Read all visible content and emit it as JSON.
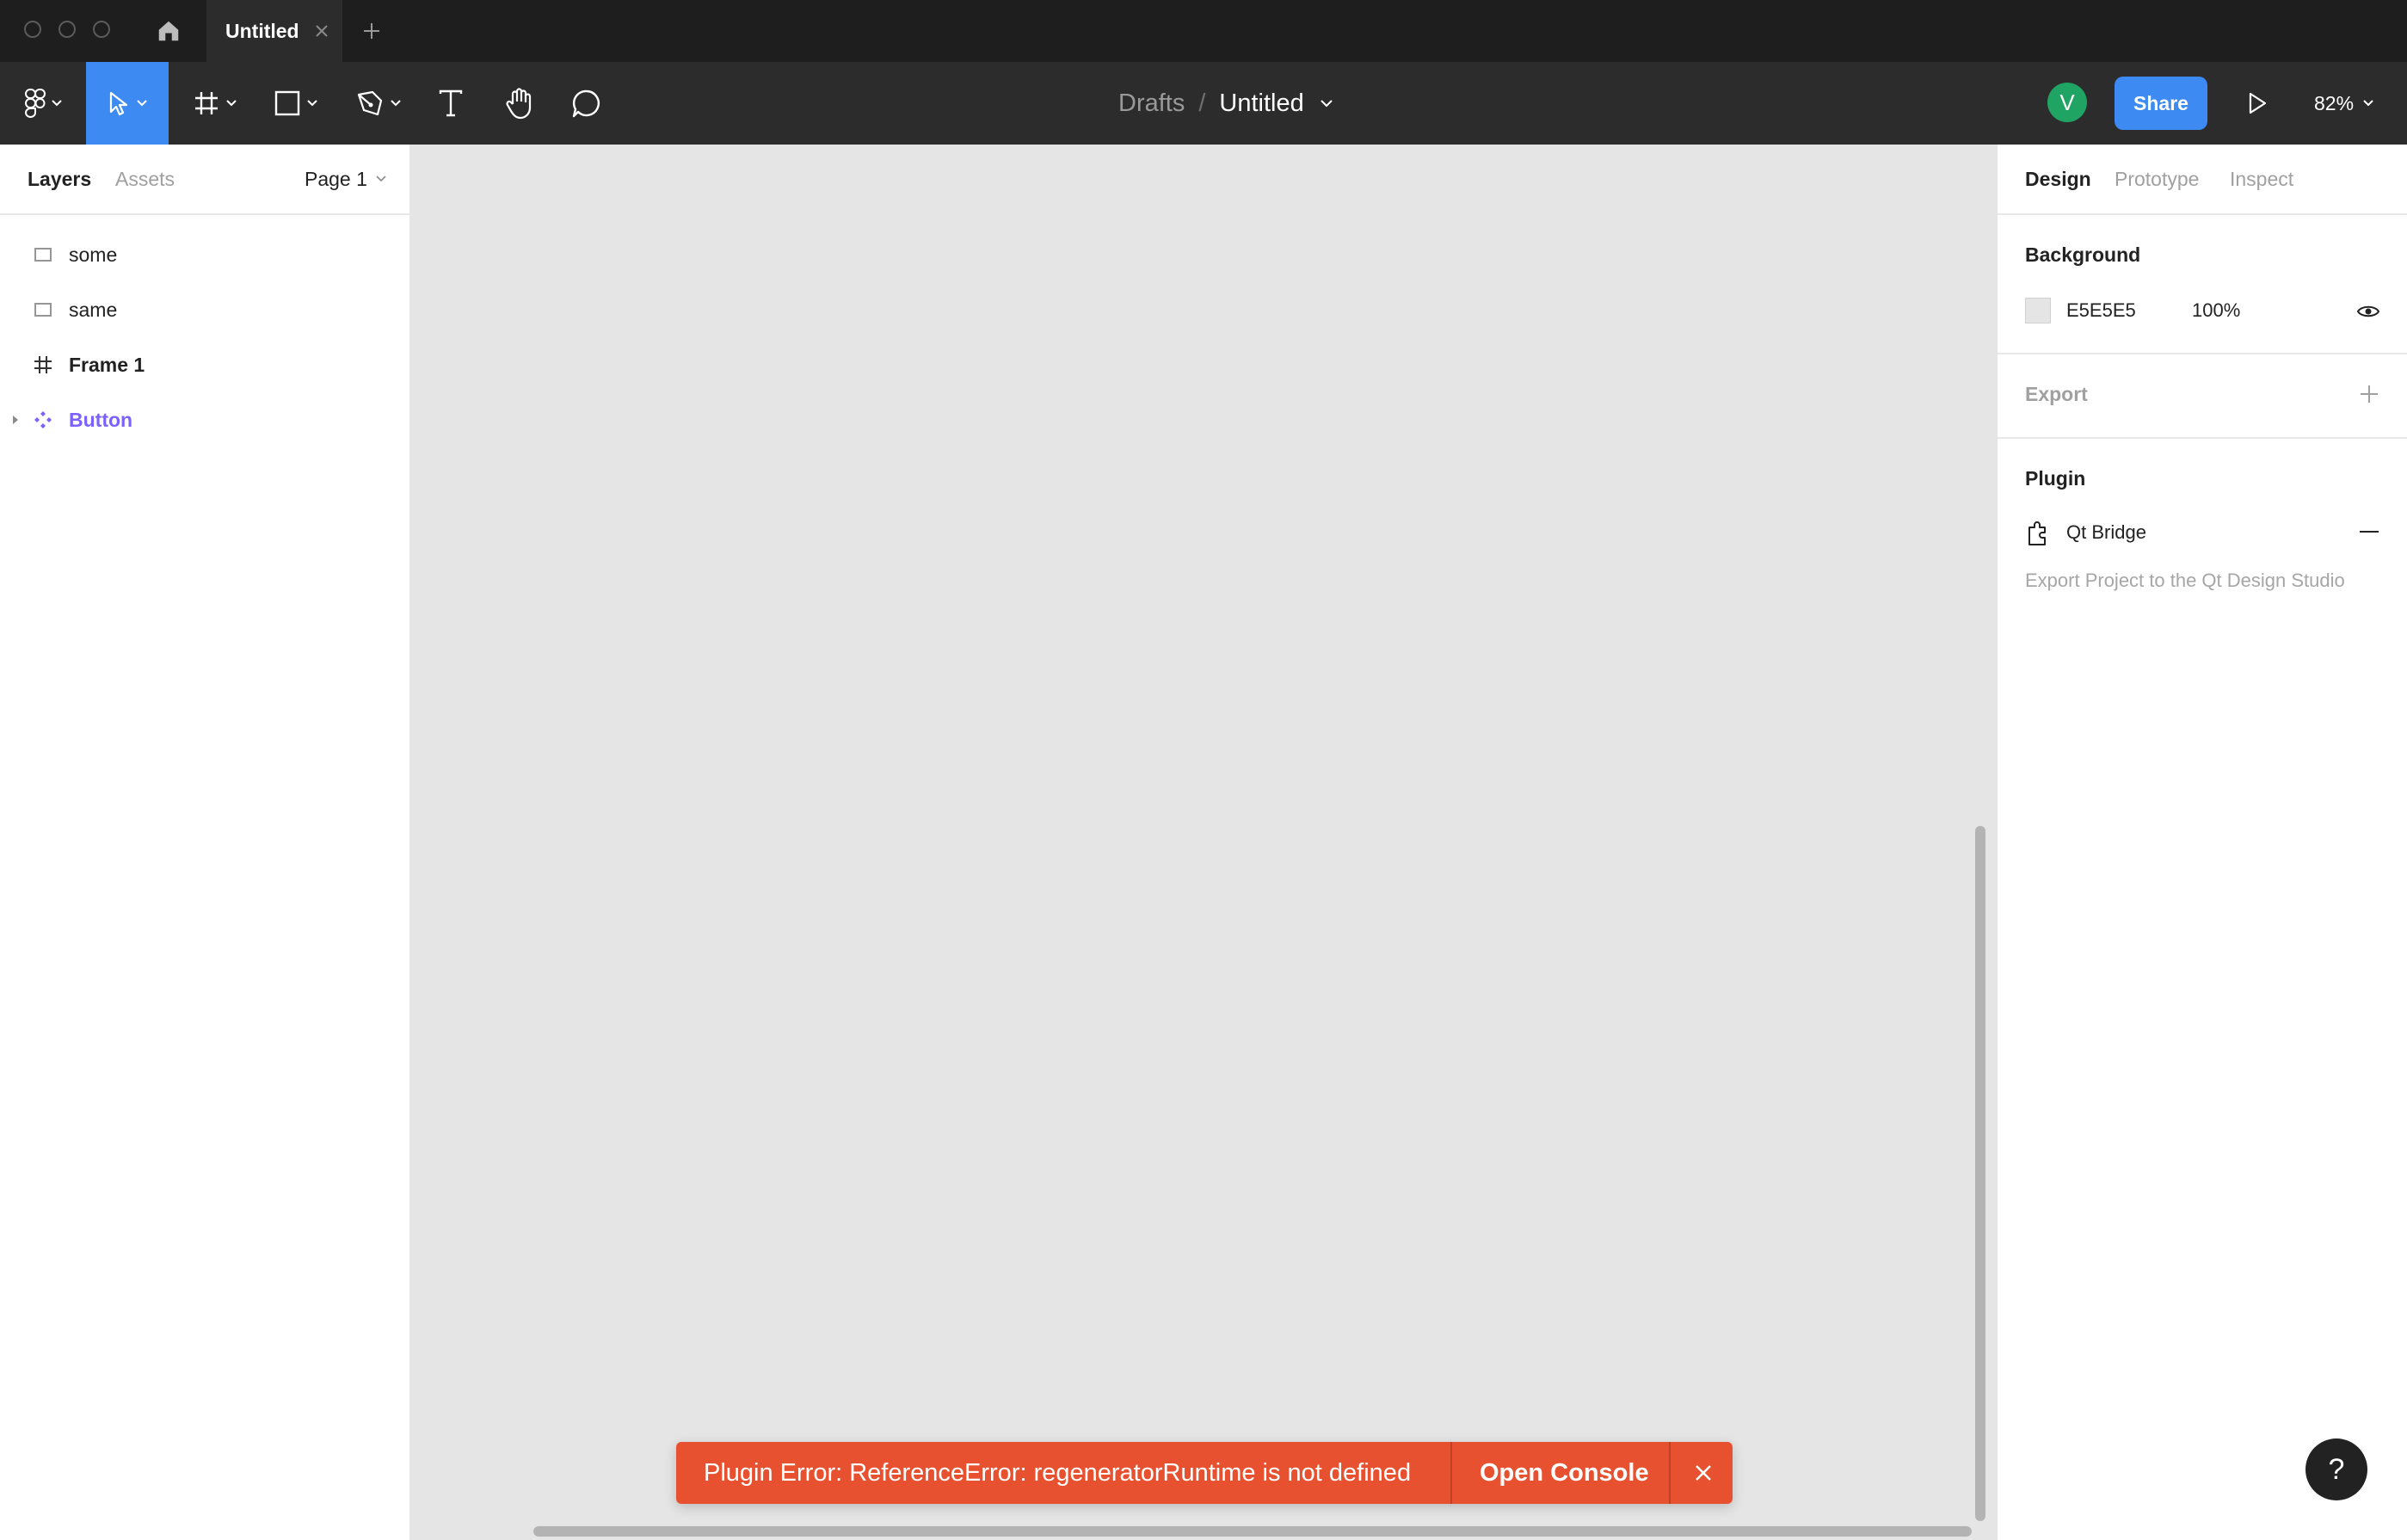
{
  "window": {
    "tab_title": "Untitled"
  },
  "toolbar": {
    "tools": [
      "main-menu",
      "move",
      "frame",
      "shape",
      "pen",
      "text",
      "hand",
      "comment"
    ],
    "breadcrumb": {
      "folder": "Drafts",
      "separator": "/",
      "file": "Untitled"
    },
    "avatar_initial": "V",
    "share_label": "Share",
    "zoom": "82%"
  },
  "left_panel": {
    "tabs": [
      {
        "label": "Layers"
      },
      {
        "label": "Assets"
      }
    ],
    "page": "Page 1",
    "layers": [
      {
        "name": "some",
        "icon": "rectangle-icon"
      },
      {
        "name": "same",
        "icon": "rectangle-icon"
      },
      {
        "name": "Frame 1",
        "icon": "frame-icon"
      },
      {
        "name": "Button",
        "icon": "component-icon"
      }
    ]
  },
  "right_panel": {
    "tabs": [
      {
        "label": "Design"
      },
      {
        "label": "Prototype"
      },
      {
        "label": "Inspect"
      }
    ],
    "background": {
      "title": "Background",
      "hex": "E5E5E5",
      "opacity": "100%"
    },
    "export": {
      "title": "Export"
    },
    "plugin": {
      "title": "Plugin",
      "name": "Qt Bridge",
      "description": "Export Project to the Qt Design Studio"
    }
  },
  "toast": {
    "message": "Plugin Error: ReferenceError: regeneratorRuntime is not defined",
    "action": "Open Console"
  },
  "help_label": "?",
  "colors": {
    "accent": "#3d8bf2",
    "error": "#e8512f",
    "component": "#7b61ff",
    "canvas": "#e5e5e5",
    "avatar": "#1fa463"
  }
}
